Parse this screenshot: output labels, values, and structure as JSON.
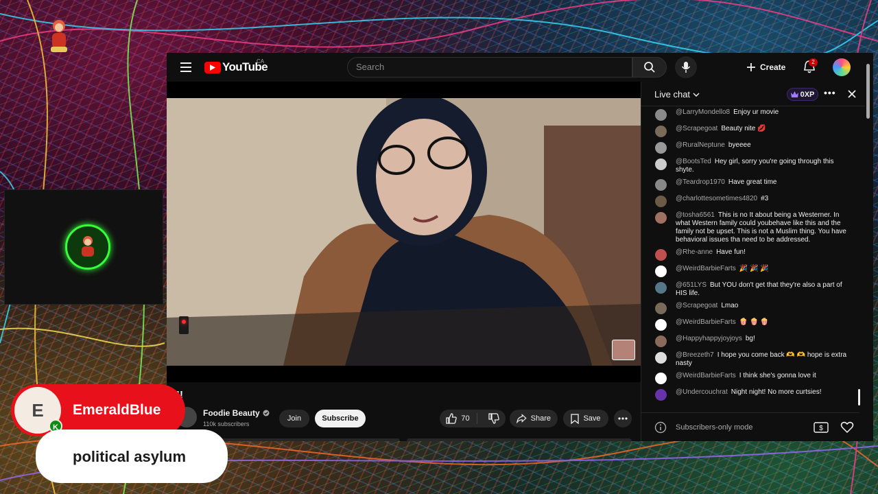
{
  "youtube": {
    "logo_text": "YouTube",
    "country_code": "CA",
    "search_placeholder": "Search",
    "create_label": "Create",
    "notification_count": "2"
  },
  "video": {
    "title": "!!",
    "channel_name": "Foodie Beauty",
    "subscribers": "110k subscribers",
    "join_label": "Join",
    "subscribe_label": "Subscribe",
    "like_count": "70",
    "share_label": "Share",
    "save_label": "Save"
  },
  "live_chat": {
    "title": "Live chat",
    "xp": "0XP",
    "footer_mode": "Subscribers-only mode",
    "messages": [
      {
        "author": "@LarryMondello8",
        "text": "Enjoy ur movie",
        "color": "#8a8a8a"
      },
      {
        "author": "@Scrapegoat",
        "text": "Beauty nite 💋",
        "color": "#7a6a5a"
      },
      {
        "author": "@RuralNeptune",
        "text": "byeeee",
        "color": "#999"
      },
      {
        "author": "@BootsTed",
        "text": "Hey girl, sorry you're going through this shyte.",
        "color": "#ccc"
      },
      {
        "author": "@Teardrop1970",
        "text": "Have great time",
        "color": "#888"
      },
      {
        "author": "@charlottesometimes4820",
        "text": "#3",
        "color": "#6b5a45"
      },
      {
        "author": "@tosha6561",
        "text": "This is no It about being a Westerner. In what Western family could youbehave like this and the family not be upset. This is not a Muslim thing. You have behavioral issues tha need to be addressed.",
        "color": "#a07060"
      },
      {
        "author": "@Rhe-anne",
        "text": "Have fun!",
        "color": "#c05050"
      },
      {
        "author": "@WeirdBarbieFarts",
        "text": "🎉 🎉 🎉",
        "color": "#fff"
      },
      {
        "author": "@651LYS",
        "text": "But YOU don't get that they're also a part of HIS life.",
        "color": "#557788"
      },
      {
        "author": "@Scrapegoat",
        "text": "Lmao",
        "color": "#7a6a5a"
      },
      {
        "author": "@WeirdBarbieFarts",
        "text": "🍿 🍿 🍿",
        "color": "#fff"
      },
      {
        "author": "@Happyhappyjoyjoys",
        "text": "bg!",
        "color": "#8a6a5a"
      },
      {
        "author": "@Breezeth7",
        "text": "I hope you come back 🫶 🫶 hope is extra nasty",
        "color": "#ddd"
      },
      {
        "author": "@WeirdBarbieFarts",
        "text": "I think she's gonna love it",
        "color": "#fff"
      },
      {
        "author": "@Undercouchrat",
        "text": "Night night! No more curtsies!",
        "color": "#6633aa"
      }
    ]
  },
  "overlay": {
    "alert_initial": "E",
    "alert_badge": "K",
    "alert_username": "EmeraldBlue",
    "alert_message": "political asylum"
  }
}
